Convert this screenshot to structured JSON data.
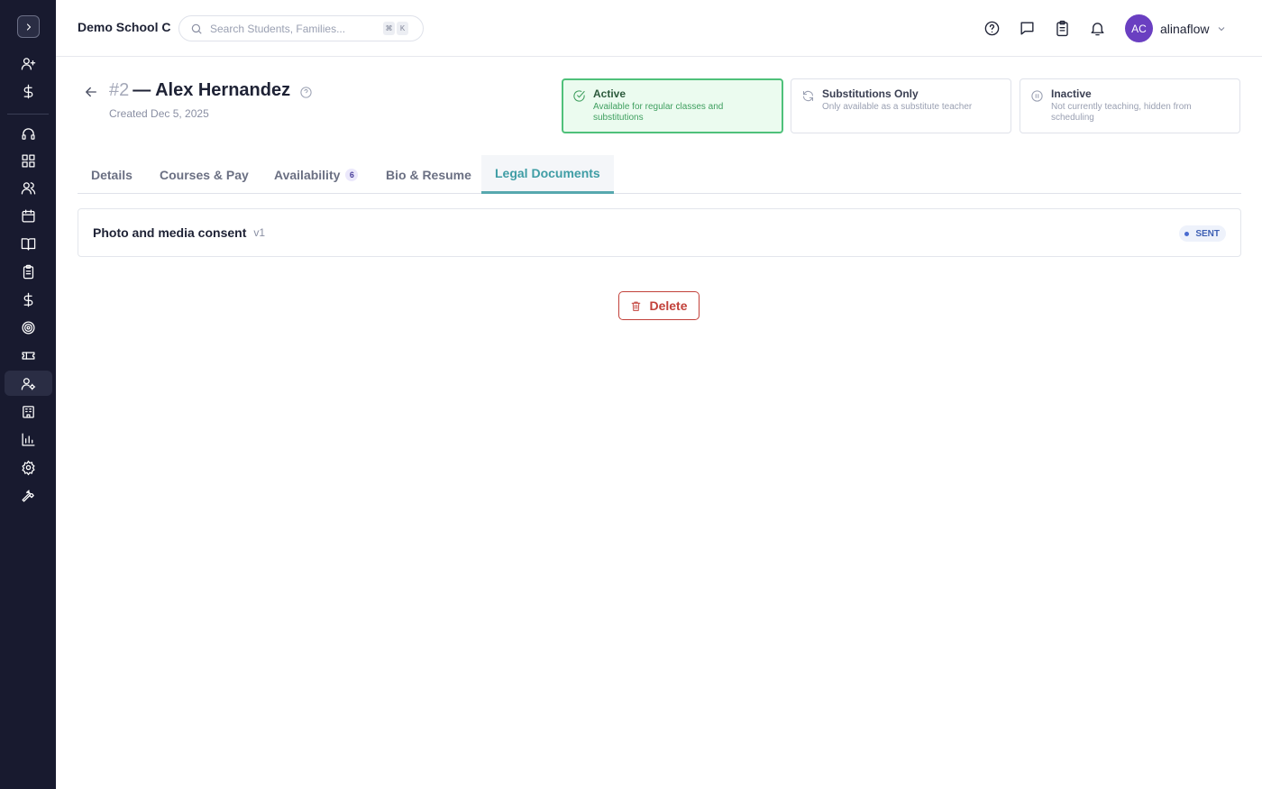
{
  "topbar": {
    "school_name": "Demo School C",
    "search_placeholder": "Search Students, Families...",
    "shortcut_keys": [
      "⌘",
      "K"
    ],
    "user_initials": "AC",
    "username": "alinaflow"
  },
  "sidebar": {
    "items": [
      {
        "icon": "user-plus-icon"
      },
      {
        "icon": "dollar-icon"
      },
      {
        "icon": "headset-icon"
      },
      {
        "icon": "dashboard-icon"
      },
      {
        "icon": "users-icon"
      },
      {
        "icon": "calendar-icon"
      },
      {
        "icon": "book-icon"
      },
      {
        "icon": "clipboard-icon"
      },
      {
        "icon": "dollar-icon"
      },
      {
        "icon": "target-icon"
      },
      {
        "icon": "ticket-icon"
      },
      {
        "icon": "user-gear-icon",
        "active": true
      },
      {
        "icon": "building-icon"
      },
      {
        "icon": "bar-chart-icon"
      },
      {
        "icon": "gear-icon"
      },
      {
        "icon": "wrench-icon"
      }
    ]
  },
  "header": {
    "number": "#2",
    "name": "— Alex Hernandez",
    "created": "Created Dec 5, 2025"
  },
  "status_options": [
    {
      "title": "Active",
      "description": "Available for regular classes and substitutions",
      "selected": true
    },
    {
      "title": "Substitutions Only",
      "description": "Only available as a substitute teacher",
      "selected": false
    },
    {
      "title": "Inactive",
      "description": "Not currently teaching, hidden from scheduling",
      "selected": false
    }
  ],
  "tabs": [
    {
      "label": "Details"
    },
    {
      "label": "Courses & Pay"
    },
    {
      "label": "Availability",
      "badge": "6"
    },
    {
      "label": "Bio & Resume"
    },
    {
      "label": "Legal Documents",
      "active": true
    }
  ],
  "documents": [
    {
      "name": "Photo and media consent",
      "version": "v1",
      "status": "SENT"
    }
  ],
  "actions": {
    "delete_label": "Delete"
  },
  "colors": {
    "sidebar_bg": "#181a2f",
    "active_tab": "#3f9da5",
    "status_selected_border": "#4fc17a",
    "delete_red": "#c2413a",
    "avatar_purple": "#6a3fc1"
  }
}
